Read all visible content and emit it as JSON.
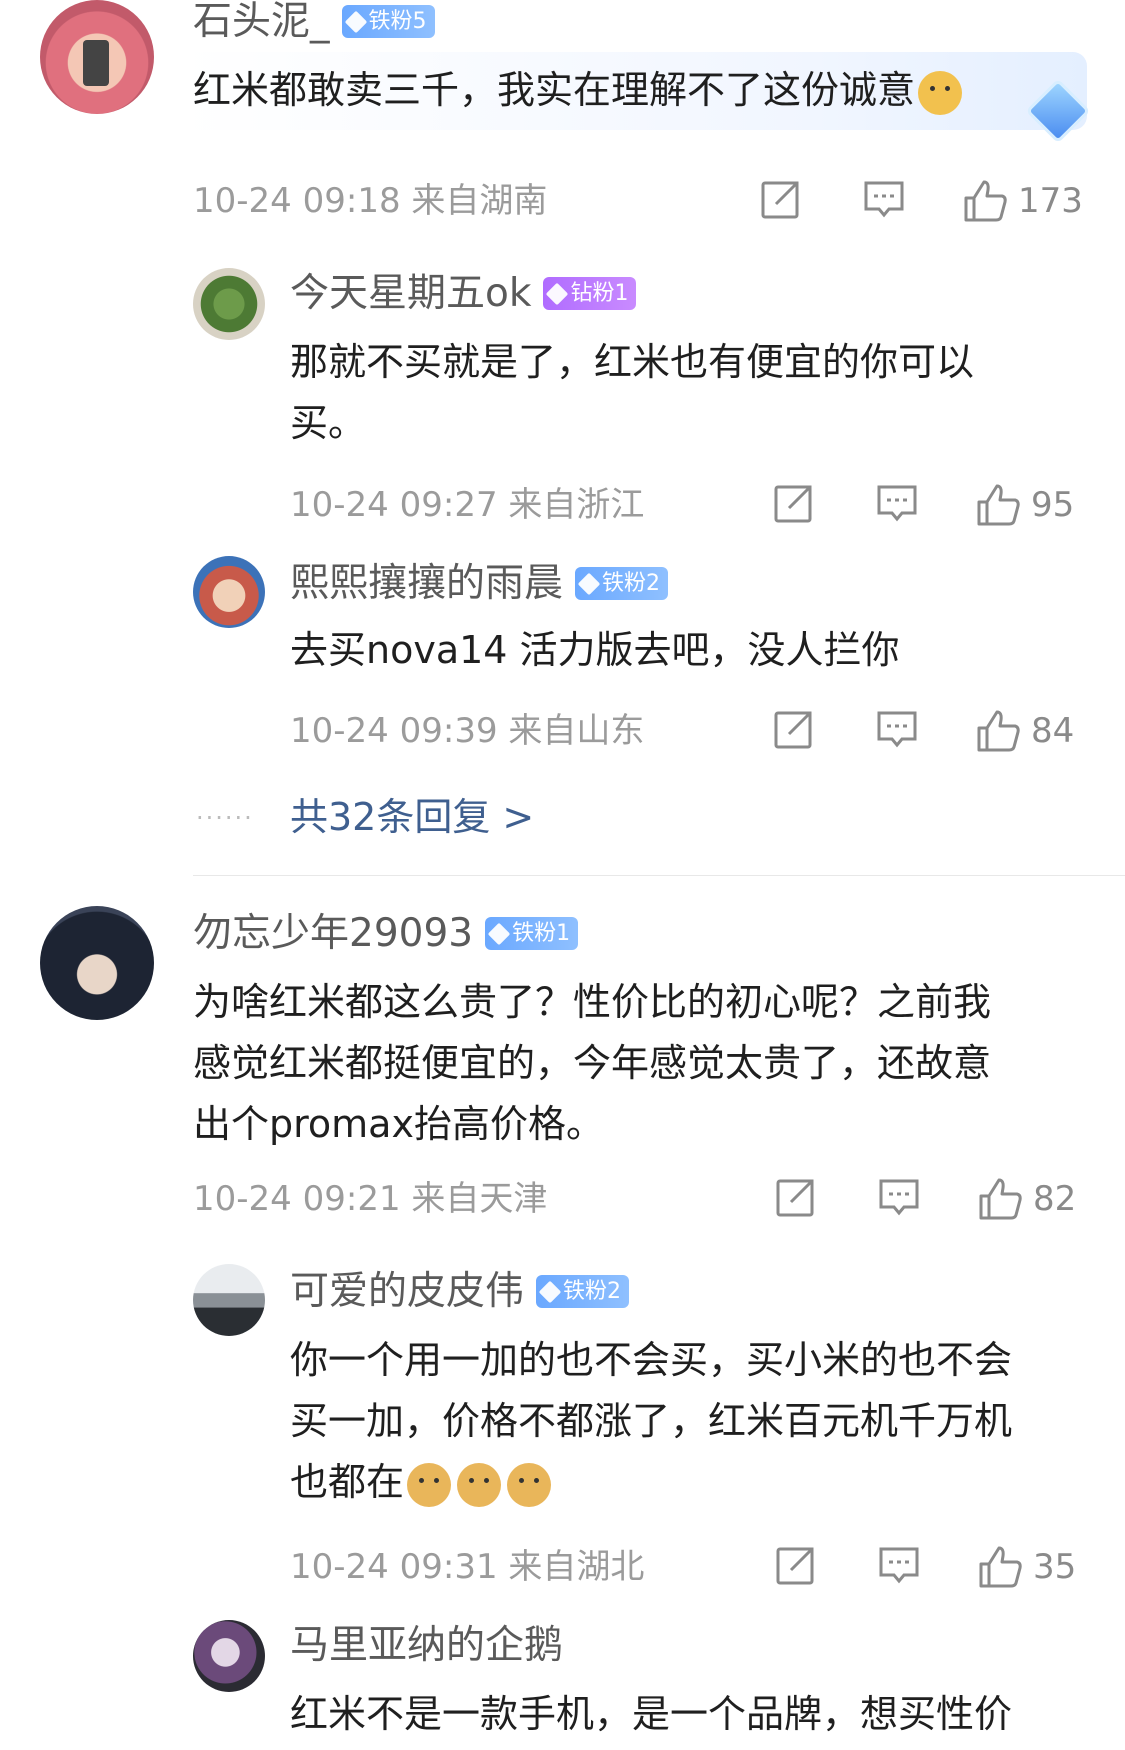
{
  "comments": [
    {
      "user": "石头泥_",
      "badge": "铁粉5",
      "text": "红米都敢卖三千，我实在理解不了这份诚意",
      "time": "10-24 09:18",
      "location": "来自湖南",
      "likes": "173"
    },
    {
      "user": "勿忘少年29093",
      "badge": "铁粉1",
      "text_lines": [
        "为啥红米都这么贵了？性价比的初心呢？之前我",
        "感觉红米都挺便宜的，今年感觉太贵了，还故意",
        "出个promax抬高价格。"
      ],
      "time": "10-24 09:21",
      "location": "来自天津",
      "likes": "82"
    }
  ],
  "replies1": [
    {
      "user": "今天星期五ok",
      "badge": "钻粉1",
      "text_lines": [
        "那就不买就是了，红米也有便宜的你可以",
        "买。"
      ],
      "time": "10-24 09:27",
      "location": "来自浙江",
      "likes": "95"
    },
    {
      "user": "熙熙攘攘的雨晨",
      "badge": "铁粉2",
      "text": "去买nova14 活力版去吧，没人拦你",
      "time": "10-24 09:39",
      "location": "来自山东",
      "likes": "84"
    }
  ],
  "more_replies": {
    "dots": "······",
    "label": "共32条回复 >"
  },
  "replies2": [
    {
      "user": "可爱的皮皮伟",
      "badge": "铁粉2",
      "text_lines": [
        "你一个用一加的也不会买，买小米的也不会",
        "买一加，价格不都涨了，红米百元机千万机",
        "也都在"
      ],
      "time": "10-24 09:31",
      "location": "来自湖北",
      "likes": "35"
    },
    {
      "user": "马里亚纳的企鹅",
      "text": "红米不是一款手机，是一个品牌，想买性价"
    }
  ],
  "icons": {
    "share": "share-icon",
    "comment": "comment-icon",
    "like": "thumbs-up-icon"
  },
  "colors": {
    "link": "#3f5f8f",
    "iron_badge": "#6aa8ff",
    "diamond_badge": "#b06cff",
    "meta": "#9b9b9b"
  }
}
